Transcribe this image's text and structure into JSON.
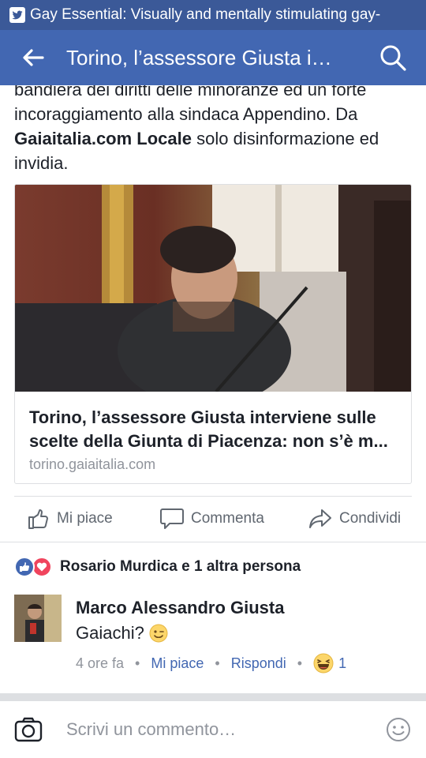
{
  "status_bar": {
    "notification_text": "Gay Essential: Visually and mentally stimulating gay-"
  },
  "app_bar": {
    "title": "Torino, l’assessore Giusta i…"
  },
  "post": {
    "text_before": "bandiera dei diritti delle minoranze ed un forte incoraggiamento alla sindaca Appendino. Da ",
    "text_bold": "Gaiaitalia.com Locale",
    "text_after": " solo disinformazione ed invidia."
  },
  "link_card": {
    "title": "Torino, l’assessore Giusta interviene sulle scelte della Giunta di Piacenza: non s’è m...",
    "domain": "torino.gaiaitalia.com"
  },
  "actions": {
    "like_label": "Mi piace",
    "comment_label": "Commenta",
    "share_label": "Condividi"
  },
  "reactions": {
    "summary": "Rosario Murdica e 1 altra persona"
  },
  "comment": {
    "author": "Marco Alessandro Giusta",
    "text": "Gaiachi?",
    "time": "4 ore fa",
    "like_label": "Mi piace",
    "reply_label": "Rispondi",
    "reaction_count": "1"
  },
  "composer": {
    "placeholder": "Scrivi un commento…"
  },
  "colors": {
    "facebook_blue": "#4267b2",
    "status_blue": "#3b5998",
    "secondary_text": "#90949c",
    "love_red": "#f0445d"
  },
  "icons": [
    "twitter-icon",
    "back-arrow-icon",
    "search-icon",
    "like-icon",
    "comment-icon",
    "share-icon",
    "camera-icon",
    "smiley-icon",
    "wink-emoji-icon",
    "laugh-emoji-icon"
  ]
}
